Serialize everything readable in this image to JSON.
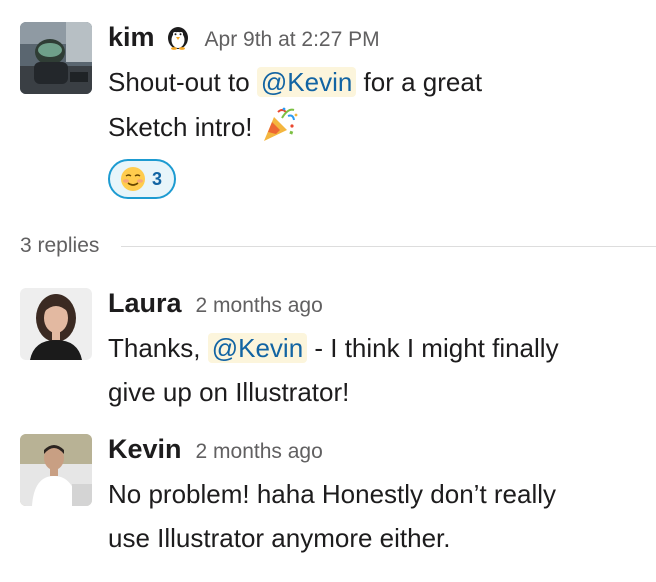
{
  "colors": {
    "mention_bg": "#fcf5dc",
    "mention_text": "#1264a3",
    "reaction_border": "#1d9bd1",
    "reaction_bg": "#e8f5fa",
    "timestamp": "#616061"
  },
  "messages": [
    {
      "author": "kim",
      "author_badge_icon": "penguin-icon",
      "timestamp": "Apr 9th at 2:27 PM",
      "text_before": "Shout-out to ",
      "mention": "@Kevin",
      "text_after": " for a great Sketch intro! ",
      "trailing_emoji_icon": "party-popper-icon",
      "reaction": {
        "emoji_icon": "smiling-face-icon",
        "count": "3"
      }
    },
    {
      "author": "Laura",
      "timestamp": "2 months ago",
      "text_before": "Thanks, ",
      "mention": "@Kevin",
      "text_after": " - I think I might finally give up on Illustrator!"
    },
    {
      "author": "Kevin",
      "timestamp": "2 months ago",
      "text": "No problem! haha Honestly don’t really use Illustrator anymore either."
    }
  ],
  "thread": {
    "replies_label": "3 replies"
  }
}
